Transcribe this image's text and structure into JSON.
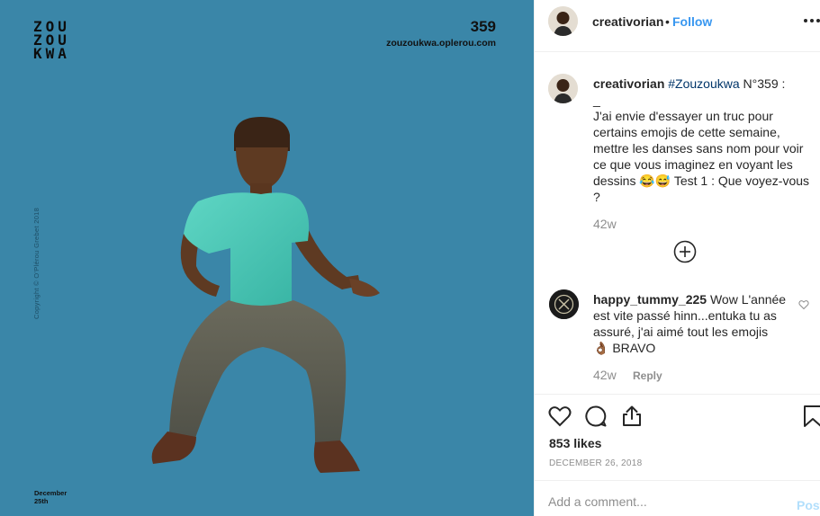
{
  "image": {
    "brand": [
      "ZOU",
      "ZOU",
      "KWA"
    ],
    "number": "359",
    "site": "zouzoukwa.oplerou.com",
    "copyright": "Copyright © O'Plérou Grebet   2018",
    "date_lines": [
      "December",
      "25th"
    ],
    "background_color": "#3a86a8"
  },
  "header": {
    "username": "creativorian",
    "separator": "•",
    "follow_label": "Follow"
  },
  "caption": {
    "username": "creativorian",
    "hashtag": "#Zouzoukwa",
    "title_suffix": " N°359 :",
    "dash": "_",
    "body": "J'ai envie d'essayer un truc pour certains emojis de cette semaine, mettre les danses sans nom pour voir ce que vous imaginez en voyant les dessins 😂😅 Test 1 : Que voyez-vous ?",
    "time": "42w"
  },
  "comment": {
    "username": "happy_tummy_225",
    "text": "Wow L'année est vite passé hinn...entuka tu as assuré, j'ai aimé tout les emojis 👌🏾 BRAVO",
    "time": "42w",
    "reply_label": "Reply"
  },
  "actions": {
    "likes": "853 likes",
    "date": "DECEMBER 26, 2018",
    "icons": [
      "heart-icon",
      "comment-bubble-icon",
      "share-icon",
      "bookmark-icon"
    ]
  },
  "add_comment": {
    "placeholder": "Add a comment...",
    "post_label": "Post"
  },
  "colors": {
    "link": "#3897f0",
    "hashtag": "#003569",
    "muted": "#8e8e8e",
    "post_disabled": "#b2dffc"
  }
}
